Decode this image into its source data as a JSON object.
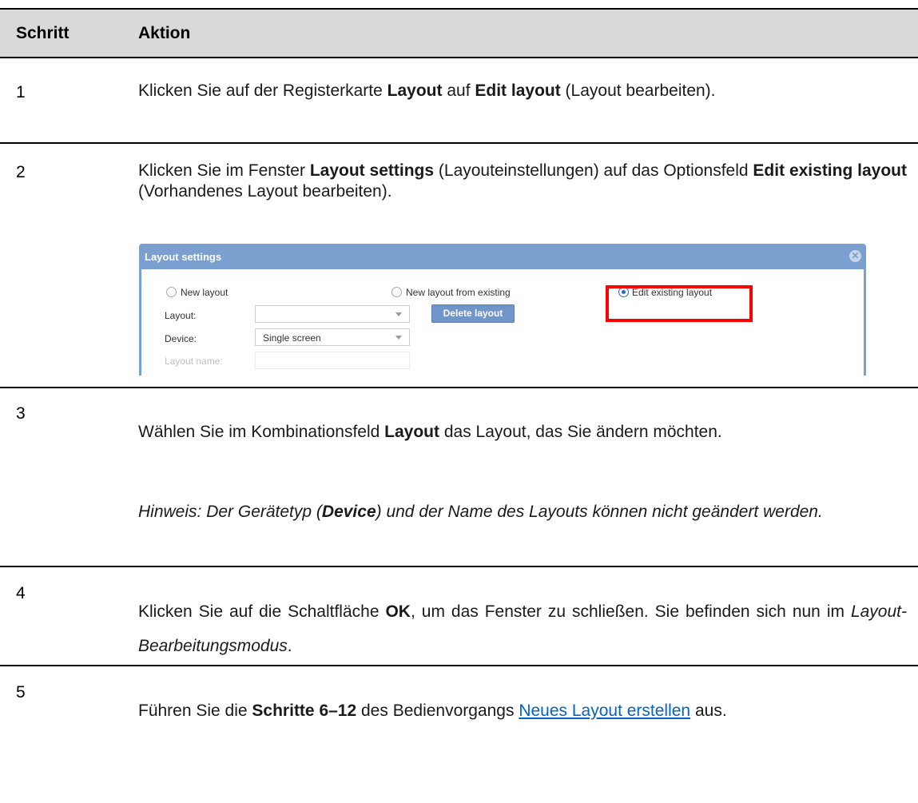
{
  "table": {
    "header": {
      "col1": "Schritt",
      "col2": "Aktion"
    },
    "rows": [
      {
        "number": "1",
        "parts": [
          "Klicken Sie auf der Registerkarte ",
          "Layout",
          " auf ",
          "Edit layout",
          " (Layout bearbeiten)."
        ]
      },
      {
        "number": "2",
        "parts": [
          "Klicken Sie im Fenster ",
          "Layout settings",
          " (Layouteinstellungen) auf das Optionsfeld ",
          "Edit existing layout",
          " (Vorhandenes Layout bearbeiten)."
        ]
      },
      {
        "number": "3",
        "parts": [
          "Wählen Sie im Kombinationsfeld ",
          "Layout",
          " das Layout, das Sie ändern möchten."
        ],
        "note_parts": [
          "Hinweis: Der Gerätetyp (",
          "Device",
          ") und der Name des Layouts können nicht geändert werden."
        ]
      },
      {
        "number": "4",
        "parts": [
          "Klicken Sie auf die Schaltfläche ",
          "OK",
          ", um das Fenster zu schließen. Sie befinden sich nun im ",
          "Layout-Bearbeitungsmodus",
          "."
        ]
      },
      {
        "number": "5",
        "parts": [
          "Führen Sie die ",
          "Schritte 6–12",
          " des Bedienvorgangs ",
          "Neues Layout erstellen",
          " aus."
        ]
      }
    ]
  },
  "dialog": {
    "title": "Layout settings",
    "close_icon": "close-circle-icon",
    "radio_new": "New layout",
    "radio_from_existing": "New layout from existing",
    "radio_edit": "Edit existing layout",
    "selected_option": "Edit existing layout",
    "layout_label": "Layout:",
    "layout_value": "",
    "delete_button": "Delete layout",
    "device_label": "Device:",
    "device_value": "Single screen",
    "name_label": "Layout name:",
    "name_value": "",
    "highlight_color": "#ff0000",
    "title_bar_color": "#7b9fcf"
  }
}
